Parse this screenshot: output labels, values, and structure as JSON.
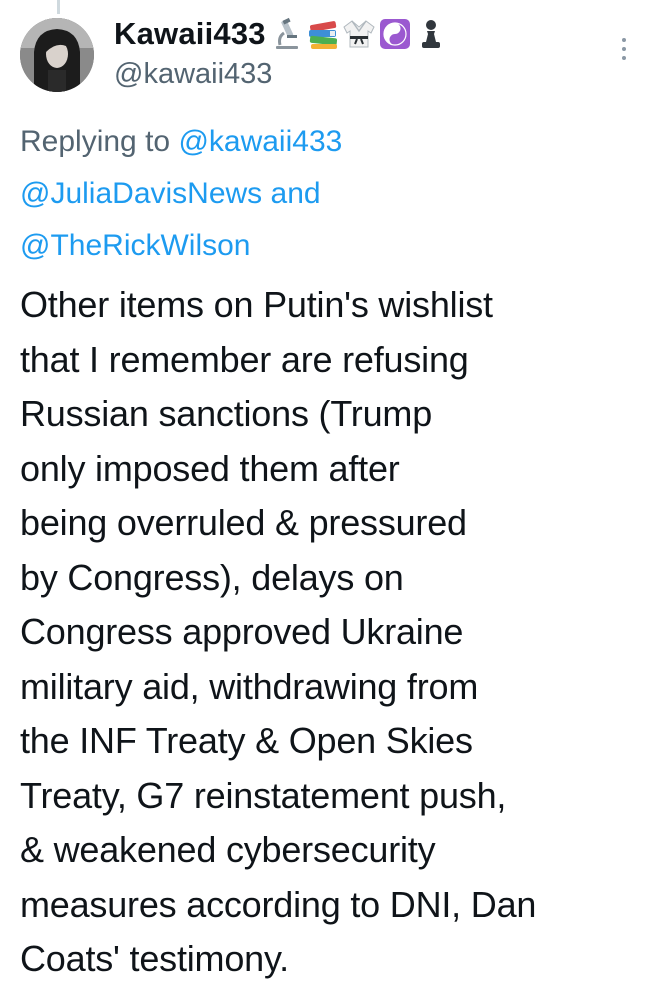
{
  "tweet": {
    "author": {
      "display_name": "Kawaii433",
      "handle": "@kawaii433",
      "name_emojis": [
        "microscope-icon",
        "books-icon",
        "martial-arts-uniform-icon",
        "yin-yang-icon",
        "chess-pawn-icon"
      ]
    },
    "reply_to": {
      "prefix": "Replying to",
      "mention_1": "@kawaii433",
      "mention_2": "@JuliaDavisNews",
      "conjunction": "and",
      "mention_3": "@TheRickWilson"
    },
    "text_lines": [
      "Other items on Putin's wishlist",
      "that I remember are refusing",
      "Russian sanctions (Trump",
      "only imposed them after",
      "being overruled & pressured",
      "by Congress), delays on",
      "Congress approved Ukraine",
      "military aid, withdrawing from",
      "the INF Treaty & Open Skies",
      "Treaty, G7 reinstatement push,",
      "& weakened cybersecurity",
      "measures according to DNI, Dan",
      "Coats' testimony."
    ]
  },
  "colors": {
    "text": "#0f1419",
    "secondary": "#536471",
    "link": "#1d9bf0",
    "yin_yang_bg": "#9b59d0"
  }
}
